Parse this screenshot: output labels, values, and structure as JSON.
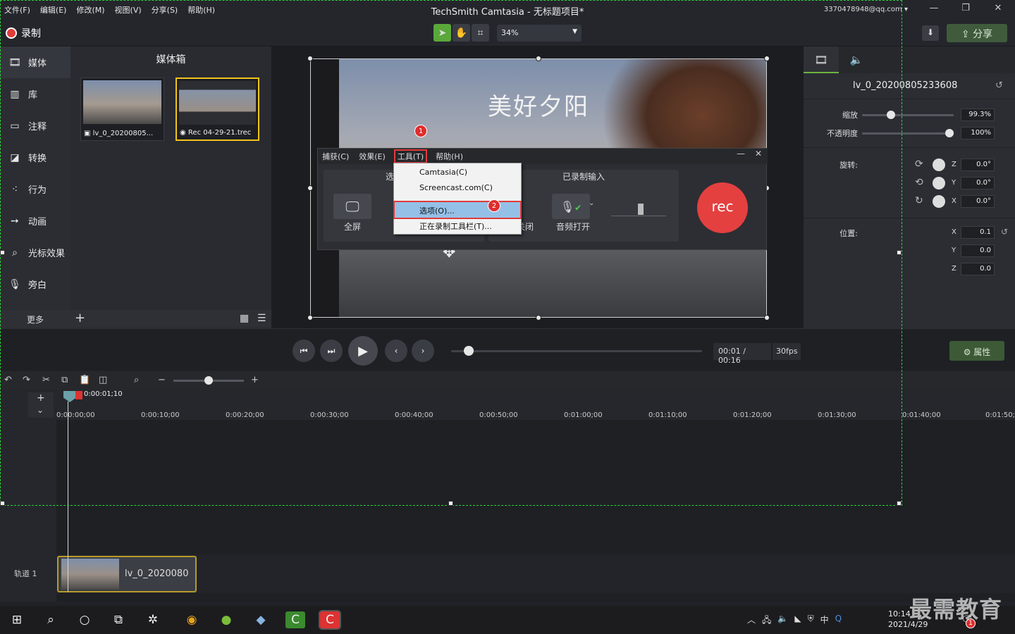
{
  "window": {
    "title": "TechSmith Camtasia - 无标题项目*",
    "account": "3370478948@qq.com",
    "menu": [
      "文件(F)",
      "编辑(E)",
      "修改(M)",
      "视图(V)",
      "分享(S)",
      "帮助(H)"
    ]
  },
  "toolbar": {
    "record_label": "录制",
    "zoom": "34%",
    "share_label": "分享"
  },
  "nav": {
    "items": [
      {
        "label": "媒体",
        "icon": "film-icon"
      },
      {
        "label": "库",
        "icon": "library-icon"
      },
      {
        "label": "注释",
        "icon": "annotation-icon"
      },
      {
        "label": "转换",
        "icon": "transition-icon"
      },
      {
        "label": "行为",
        "icon": "behavior-icon"
      },
      {
        "label": "动画",
        "icon": "animation-icon"
      },
      {
        "label": "光标效果",
        "icon": "cursor-icon"
      },
      {
        "label": "旁白",
        "icon": "mic-icon"
      }
    ],
    "more": "更多"
  },
  "mediabin": {
    "title": "媒体箱",
    "items": [
      {
        "name": "lv_0_20200805..."
      },
      {
        "name": "Rec 04-29-21.trec"
      }
    ]
  },
  "canvas": {
    "video_title": "美好夕阳"
  },
  "recorder": {
    "menu": [
      "捕获(C)",
      "效果(E)",
      "工具(T)",
      "帮助(H)"
    ],
    "select_head": "选",
    "fullscreen": "全屏",
    "audio_head": "已录制输入",
    "cam_off": "关闭",
    "audio_on": "音频打开",
    "rec": "rec"
  },
  "dropdown": {
    "items": [
      "Camtasia(C)",
      "Screencast.com(C)",
      "选项(O)...",
      "正在录制工具栏(T)..."
    ]
  },
  "badges": {
    "one": "1",
    "two": "2"
  },
  "props": {
    "clip_name": "lv_0_20200805233608",
    "scale_label": "缩放",
    "scale": "99.3%",
    "scale_level": 0.3,
    "opacity_label": "不透明度",
    "opacity": "100%",
    "opacity_level": 1.0,
    "rotation_label": "旋转:",
    "rot_z": "0.0°",
    "rot_y": "0.0°",
    "rot_x": "0.0°",
    "position_label": "位置:",
    "pos_x": "0.1",
    "pos_y": "0.0",
    "pos_z": "0.0",
    "axis": {
      "x": "X",
      "y": "Y",
      "z": "Z"
    }
  },
  "playback": {
    "timecode": "00:01 / 00:16",
    "fps": "30fps",
    "props_button": "属性",
    "progress": 0.07
  },
  "timeline": {
    "playhead": "0:00:01;10",
    "ticks": [
      "0:00:00;00",
      "0:00:10;00",
      "0:00:20;00",
      "0:00:30;00",
      "0:00:40;00",
      "0:00:50;00",
      "0:01:00;00",
      "0:01:10;00",
      "0:01:20;00",
      "0:01:30;00",
      "0:01:40;00",
      "0:01:50;"
    ],
    "track_label": "轨道 1",
    "clip_name": "lv_0_2020080"
  },
  "taskbar": {
    "time": "10:14",
    "date": "2021/4/29",
    "ime": "中",
    "notif": "1"
  },
  "watermark": "最需教育"
}
